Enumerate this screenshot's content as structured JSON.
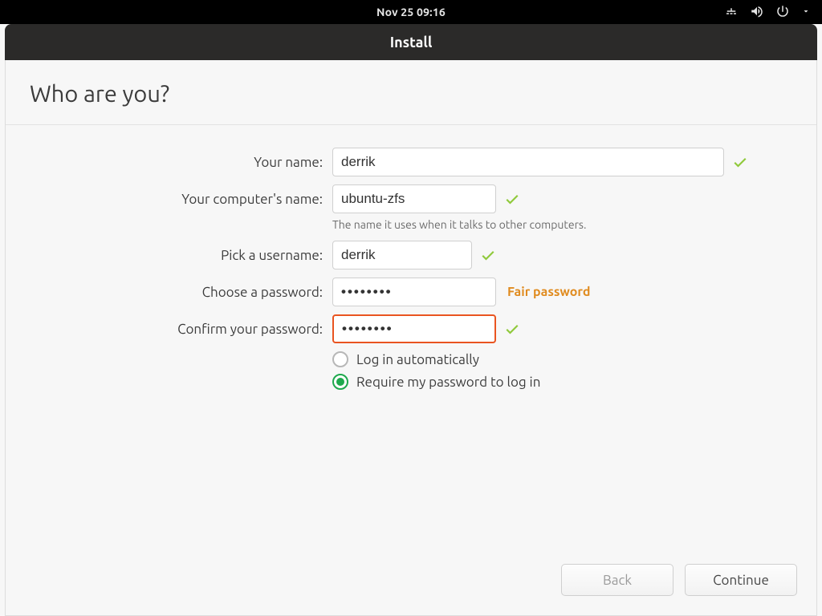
{
  "topbar": {
    "datetime": "Nov 25  09:16"
  },
  "window": {
    "title": "Install"
  },
  "page": {
    "heading": "Who are you?"
  },
  "form": {
    "name": {
      "label": "Your name:",
      "value": "derrik"
    },
    "computer": {
      "label": "Your computer's name:",
      "value": "ubuntu-zfs",
      "hint": "The name it uses when it talks to other computers."
    },
    "username": {
      "label": "Pick a username:",
      "value": "derrik"
    },
    "password": {
      "label": "Choose a password:",
      "value": "••••••••",
      "strength": "Fair password"
    },
    "confirm": {
      "label": "Confirm your password:",
      "value": "••••••••"
    },
    "login_options": {
      "auto": {
        "label": "Log in automatically",
        "selected": false
      },
      "require": {
        "label": "Require my password to log in",
        "selected": true
      }
    }
  },
  "footer": {
    "back": "Back",
    "continue": "Continue"
  }
}
